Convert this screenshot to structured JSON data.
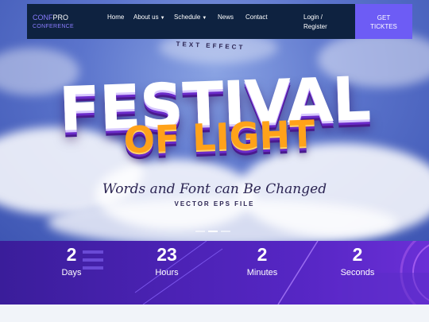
{
  "navbar": {
    "logo_line1_a": "CONF",
    "logo_line1_b": "PRO",
    "logo_line2": "CONFERENCE",
    "items": [
      {
        "label": "Home",
        "dropdown": false
      },
      {
        "label": "About us",
        "dropdown": true
      },
      {
        "label": "Schedule",
        "dropdown": true
      },
      {
        "label": "News",
        "dropdown": false
      },
      {
        "label": "Contact",
        "dropdown": false
      }
    ],
    "login_line1": "Login /",
    "login_line2": "Register",
    "cta_line1": "GET",
    "cta_line2": "TICKTES",
    "caret_icon": "caret-down-icon"
  },
  "hero": {
    "effect_label": "TEXT EFFECT",
    "title_line1": "FESTIVAL",
    "title_line2": "OF LIGHT",
    "script_line": "Words and Font can Be Changed",
    "vector_line": "VECTOR EPS FILE",
    "slides": 3,
    "active_slide": 2
  },
  "countdown": [
    {
      "value": "2",
      "label": "Days"
    },
    {
      "value": "23",
      "label": "Hours"
    },
    {
      "value": "2",
      "label": "Minutes"
    },
    {
      "value": "2",
      "label": "Seconds"
    }
  ],
  "colors": {
    "nav_bg": "#0e2240",
    "accent": "#6d5cf5",
    "countdown_bg": "#4b22b4",
    "title_orange": "#ffa21a"
  }
}
